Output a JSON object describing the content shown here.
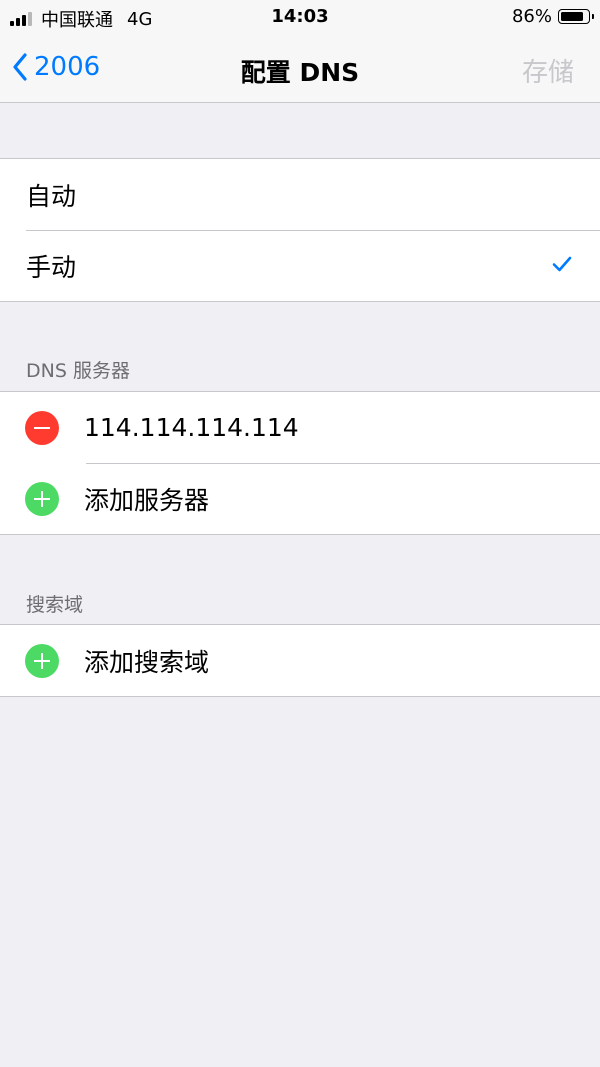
{
  "status_bar": {
    "carrier": "中国联通",
    "network": "4G",
    "time": "14:03",
    "battery_percent": "86%",
    "battery_level": 0.86,
    "signal_bars": 3,
    "signal_total": 4
  },
  "nav": {
    "back_label": "2006",
    "title": "配置 DNS",
    "save_label": "存储"
  },
  "mode": {
    "items": [
      {
        "label": "自动",
        "selected": false
      },
      {
        "label": "手动",
        "selected": true
      }
    ]
  },
  "dns_servers": {
    "header": "DNS 服务器",
    "entries": [
      "114.114.114.114"
    ],
    "add_label": "添加服务器"
  },
  "search_domains": {
    "header": "搜索域",
    "add_label": "添加搜索域"
  },
  "colors": {
    "accent": "#007aff",
    "delete": "#ff3b30",
    "add": "#4cd964",
    "disabled": "#c7c7cc",
    "background": "#efeff4"
  }
}
